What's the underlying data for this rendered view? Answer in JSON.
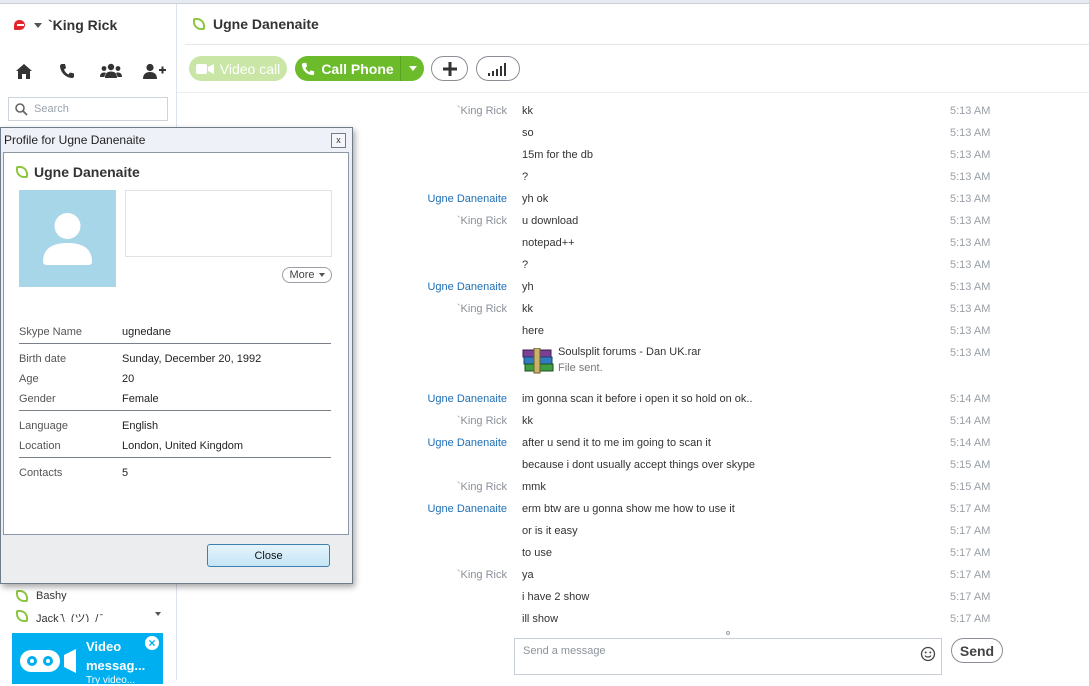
{
  "account": {
    "name": "`King Rick",
    "status_icon": "skype-status-icon",
    "status_color": "#e4252c"
  },
  "nav": {
    "icons": [
      "home-icon",
      "phone-icon",
      "contacts-icon",
      "add-contact-icon"
    ]
  },
  "search": {
    "placeholder": "Search"
  },
  "contacts": [
    {
      "name": "Bashy"
    },
    {
      "name": "Jack ̄\\_(ツ)_/ ̄"
    }
  ],
  "promo": {
    "title": "Video messag...",
    "subtitle": "Try video...",
    "close": "×",
    "bg_color": "#00aff0"
  },
  "conversation": {
    "name": "Ugne Danenaite",
    "buttons": {
      "video_call": "Video call",
      "call_phone": "Call Phone"
    },
    "accent_color": "#6cbb2b"
  },
  "messages": [
    {
      "sender": "`King Rick",
      "text": "kk",
      "time": "5:13 AM",
      "from_me": true
    },
    {
      "sender": "",
      "text": "so",
      "time": "5:13 AM",
      "from_me": true
    },
    {
      "sender": "",
      "text": "15m for the db",
      "time": "5:13 AM",
      "from_me": true
    },
    {
      "sender": "",
      "text": "?",
      "time": "5:13 AM",
      "from_me": true
    },
    {
      "sender": "Ugne Danenaite",
      "text": "yh ok",
      "time": "5:13 AM",
      "from_me": false
    },
    {
      "sender": "`King Rick",
      "text": "u download",
      "time": "5:13 AM",
      "from_me": true
    },
    {
      "sender": "",
      "text": "notepad++",
      "time": "5:13 AM",
      "from_me": true
    },
    {
      "sender": "",
      "text": "?",
      "time": "5:13 AM",
      "from_me": true
    },
    {
      "sender": "Ugne Danenaite",
      "text": "yh",
      "time": "5:13 AM",
      "from_me": false
    },
    {
      "sender": "`King Rick",
      "text": "kk",
      "time": "5:13 AM",
      "from_me": true
    },
    {
      "sender": "",
      "text": "here",
      "time": "5:13 AM",
      "from_me": true
    },
    {
      "sender": "",
      "file_name": "Soulsplit forums - Dan UK.rar",
      "file_status": "File sent.",
      "time": "5:13 AM",
      "from_me": true,
      "is_file": true
    },
    {
      "sender": "Ugne Danenaite",
      "text": "im gonna scan it before i open it so hold on ok..",
      "time": "5:14 AM",
      "from_me": false
    },
    {
      "sender": "`King Rick",
      "text": "kk",
      "time": "5:14 AM",
      "from_me": true
    },
    {
      "sender": "Ugne Danenaite",
      "text": "after u send it to me im going to scan it",
      "time": "5:14 AM",
      "from_me": false
    },
    {
      "sender": "",
      "text": "because i dont usually accept things over skype",
      "time": "5:15 AM",
      "from_me": false
    },
    {
      "sender": "`King Rick",
      "text": "mmk",
      "time": "5:15 AM",
      "from_me": true
    },
    {
      "sender": "Ugne Danenaite",
      "text": "erm btw are u gonna show me how to use it",
      "time": "5:17 AM",
      "from_me": false
    },
    {
      "sender": "",
      "text": "or is it easy",
      "time": "5:17 AM",
      "from_me": false
    },
    {
      "sender": "",
      "text": "to use",
      "time": "5:17 AM",
      "from_me": false
    },
    {
      "sender": "`King Rick",
      "text": "ya",
      "time": "5:17 AM",
      "from_me": true
    },
    {
      "sender": "",
      "text": "i have 2 show",
      "time": "5:17 AM",
      "from_me": true
    },
    {
      "sender": "",
      "text": "ill show",
      "time": "5:17 AM",
      "from_me": true
    }
  ],
  "composer": {
    "placeholder": "Send a message",
    "send_label": "Send"
  },
  "profile_dialog": {
    "title": "Profile for Ugne Danenaite",
    "close_x": "x",
    "name": "Ugne Danenaite",
    "more_label": "More",
    "close_label": "Close",
    "groups": [
      [
        {
          "label": "Skype Name",
          "value": "ugnedane"
        }
      ],
      [
        {
          "label": "Birth date",
          "value": "Sunday, December 20, 1992"
        },
        {
          "label": "Age",
          "value": "20"
        },
        {
          "label": "Gender",
          "value": "Female"
        }
      ],
      [
        {
          "label": "Language",
          "value": "English"
        },
        {
          "label": "Location",
          "value": "London, United Kingdom"
        }
      ],
      [
        {
          "label": "Contacts",
          "value": "5"
        }
      ]
    ]
  }
}
